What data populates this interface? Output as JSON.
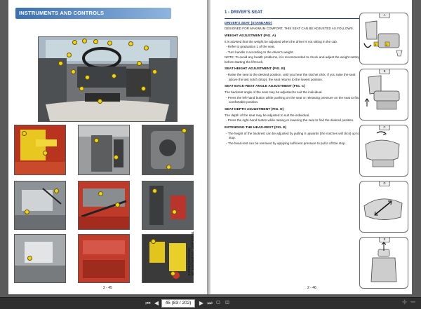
{
  "left_page": {
    "section_title": "INSTRUMENTS AND CONTROLS",
    "side_code_line1": "647096 (20/03/2018)",
    "side_code_line2": "MT 1440/1840 HA - 100P ST3 S1",
    "page_number": "2 - 45"
  },
  "right_page": {
    "heading": "1 - DRIVER'S SEAT",
    "subheading": "DRIVER'S SEAT (STANDARD)",
    "intro": "DESIGNED FOR MAXIMUM COMFORT, THIS SEAT CAN BE ADJUSTED AS FOLLOWS.",
    "weight_title": "WEIGHT ADJUSTMENT (FIG. A)",
    "weight_text": "It is advised that the weight be adjusted when the driver is not sitting in the cab.",
    "weight_bullets": [
      "- Refer to graduation 1 of the seat.",
      "- Turn handle 2 according to the driver's weight."
    ],
    "weight_note": "NOTE: To avoid any health problems, it is recommended to check and adjust the weight setting before starting the lift truck.",
    "height_title": "SEAT HEIGHT ADJUSTMENT (FIG. B)",
    "height_bullets": [
      "- Raise the seat to the desired position, until you hear the ratchet click. If you raise the seat above the last notch (stop), the seat returns to the lowest position."
    ],
    "back_title": "SEAT BACK-REST ANGLE ADJUSTMENT (FIG. C)",
    "back_text": "The backrest angle of the seat may be adjusted to suit the individual.",
    "back_bullets": [
      "- Press the left-hand button while pushing on the seat or releasing pressure on the seat to find a comfortable position."
    ],
    "depth_title": "SEAT DEPTH ADJUSTMENT (FIG. D)",
    "depth_text": "The depth of the seat may be adjusted to suit the individual.",
    "depth_bullets": [
      "- Press the right-hand button while raising or lowering the seat to find the desired position."
    ],
    "head_title": "EXTENDING THE HEAD-REST (FIG. E)",
    "head_bullets": [
      "- The height of the backrest can be adjusted by pulling it upwards (the notches will click) up to the stop.",
      "- The head-rest can be removed by applying sufficient pressure to pull it off the stop."
    ],
    "page_number": "2 - 46",
    "figures": [
      "A",
      "B",
      "C",
      "D",
      "E"
    ],
    "fig_a_labels": [
      "1",
      "2"
    ]
  },
  "toolbar": {
    "first_icon": "first-page-icon",
    "prev_icon": "prev-page-icon",
    "page_value": "45 (83 / 202)",
    "next_icon": "next-page-icon",
    "last_icon": "last-page-icon"
  }
}
